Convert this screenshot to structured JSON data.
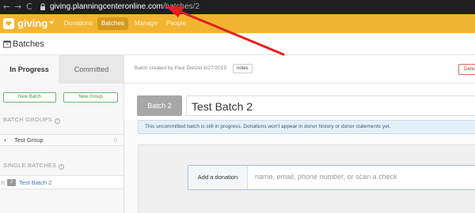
{
  "browser": {
    "back": "←",
    "forward": "→",
    "reload": "C",
    "url_host": "giving.planningcenteronline.com",
    "url_path": "/batches/2"
  },
  "header": {
    "brand": "giving",
    "nav": [
      "Donations",
      "Batches",
      "Manage",
      "People"
    ],
    "active_nav": "Batches",
    "brand_color": "#f3b531"
  },
  "page": {
    "title": "Batches"
  },
  "sidebar": {
    "tabs": [
      "In Progress",
      "Committed"
    ],
    "new_batch": "New Batch",
    "new_group": "New Group",
    "batch_groups_label": "BATCH GROUPS",
    "group": {
      "name": "Test Group",
      "count": "0"
    },
    "single_batches_label": "SINGLE BATCHES",
    "single": {
      "badge": "2",
      "name": "Test Batch 2"
    }
  },
  "main": {
    "meta": "Batch created by Paul Dietzel 8/27/2019",
    "notes": "notes",
    "delete": "Delet",
    "batch_badge": "Batch 2",
    "batch_title": "Test Batch 2",
    "notice": "This uncommitted batch is still in progress. Donations won't appear in donor history or donor statements yet.",
    "add_donation_label": "Add a donation",
    "add_donation_placeholder": "name, email, phone number, or scan a check"
  },
  "icons": {
    "lock": "lock-icon",
    "logo": "heart-icon",
    "batches": "box-icon",
    "info": "info-icon",
    "chevron": "chevron-right-icon",
    "drag": "drag-handle-icon"
  }
}
